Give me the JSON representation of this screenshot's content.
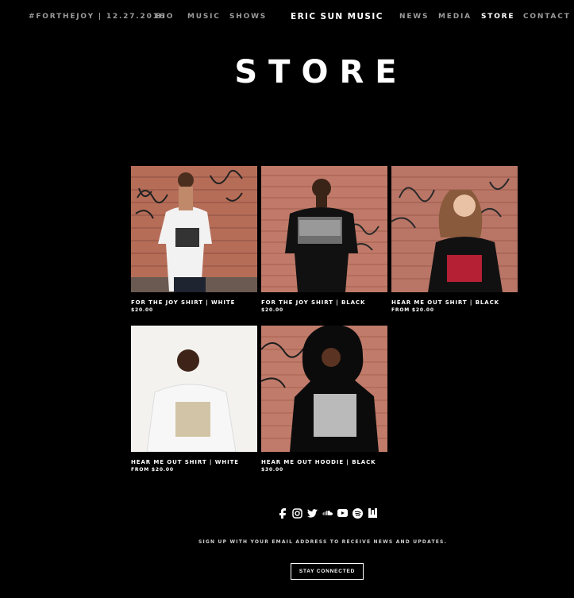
{
  "nav": {
    "hashtag": "#FORTHEJOY | 12.27.2016",
    "left_items": [
      "BIO",
      "MUSIC",
      "SHOWS"
    ],
    "brand": "ERIC SUN MUSIC",
    "right_items": [
      "NEWS",
      "MEDIA",
      "STORE",
      "CONTACT"
    ],
    "active": "STORE"
  },
  "page": {
    "title": "STORE"
  },
  "products": [
    {
      "name": "FOR THE JOY SHIRT | WHITE",
      "price": "$20.00"
    },
    {
      "name": "FOR THE JOY SHIRT | BLACK",
      "price": "$20.00"
    },
    {
      "name": "HEAR ME OUT SHIRT | BLACK",
      "price": "FROM $20.00"
    },
    {
      "name": "HEAR ME OUT SHIRT | WHITE",
      "price": "FROM $20.00"
    },
    {
      "name": "HEAR ME OUT HOODIE | BLACK",
      "price": "$30.00"
    }
  ],
  "social_icons": [
    "facebook-icon",
    "instagram-icon",
    "twitter-icon",
    "soundcloud-icon",
    "youtube-icon",
    "spotify-icon",
    "bandsintown-icon"
  ],
  "footer": {
    "signup_text": "SIGN UP WITH YOUR EMAIL ADDRESS TO RECEIVE NEWS AND UPDATES.",
    "button_label": "STAY CONNECTED"
  },
  "colors": {
    "background": "#000000",
    "nav_inactive": "#9a9a9a",
    "text": "#ffffff",
    "brick": "#b66d58"
  }
}
